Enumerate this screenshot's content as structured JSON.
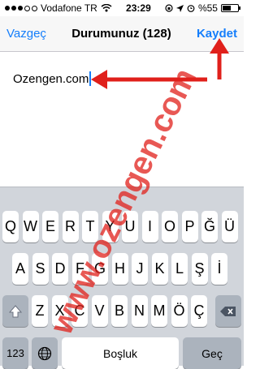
{
  "status": {
    "carrier": "Vodafone TR",
    "time": "23:29",
    "battery_text": "%55",
    "battery_level": 0.55,
    "signal_icon": "signal-dots-icon",
    "wifi_icon": "wifi-icon",
    "location_icon": "location-arrow-icon",
    "alarm_icon": "alarm-clock-icon",
    "lock_icon": "rotation-lock-icon"
  },
  "nav": {
    "cancel": "Vazgeç",
    "title": "Durumunuz (128)",
    "save": "Kaydet"
  },
  "editor": {
    "value": "Ozengen.com"
  },
  "watermark_text": "www.ozengen.com",
  "keyboard": {
    "row1": [
      "Q",
      "W",
      "E",
      "R",
      "T",
      "Y",
      "U",
      "I",
      "O",
      "P",
      "Ğ",
      "Ü"
    ],
    "row2": [
      "A",
      "S",
      "D",
      "F",
      "G",
      "H",
      "J",
      "K",
      "L",
      "Ş",
      "İ"
    ],
    "row3": [
      "Z",
      "X",
      "C",
      "V",
      "B",
      "N",
      "M",
      "Ö",
      "Ç"
    ],
    "shift_icon": "shift-arrow-icon",
    "delete_icon": "backspace-icon",
    "numbers_label": "123",
    "globe_icon": "globe-icon",
    "space_label": "Boşluk",
    "return_label": "Geç"
  },
  "colors": {
    "accent": "#157efb",
    "annotation": "#e0201b",
    "keyboard_bg": "#d1d5db"
  }
}
